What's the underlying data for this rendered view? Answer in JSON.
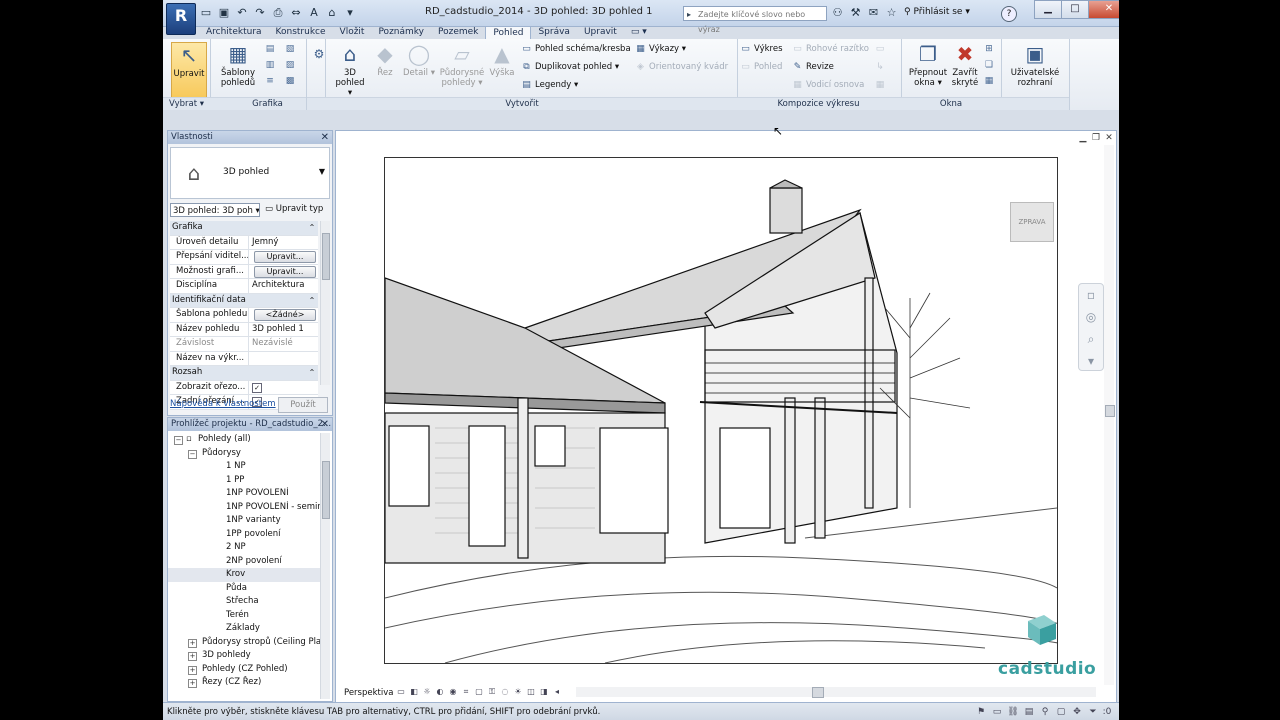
{
  "titlebar": {
    "app_menu": "R",
    "title": "RD_cadstudio_2014 - 3D pohled: 3D pohled 1",
    "search_placeholder": "Zadejte klíčové slovo nebo výraz",
    "signin": "Přihlásit se",
    "help": "?"
  },
  "tabs": [
    "Architektura",
    "Konstrukce",
    "Vložit",
    "Poznámky",
    "Pozemek",
    "Pohled",
    "Správa",
    "Upravit"
  ],
  "ribbon": {
    "select": {
      "upravit": "Upravit",
      "label": "Vybrat"
    },
    "grafika": {
      "sablony": [
        "Šablony",
        "pohledů"
      ],
      "label": "Grafika"
    },
    "vytvorit": {
      "pohled3d": [
        "3D",
        "pohled"
      ],
      "rez": "Řez",
      "detail": "Detail",
      "pudorysne": [
        "Půdorysné",
        "pohledy"
      ],
      "vyska": "Výška",
      "schema": "Pohled schéma/kresba",
      "duplikovat": "Duplikovat pohled",
      "legendy": "Legendy",
      "vykazy": "Výkazy",
      "orientovany": "Orientovaný kvádr",
      "label": "Vytvořit"
    },
    "kompozice": {
      "vykres": "Výkres",
      "pohled": "Pohled",
      "rohove": "Rohové razítko",
      "revize": "Revize",
      "vodici": "Vodicí osnova",
      "label": "Kompozice výkresu"
    },
    "okna": {
      "prepnout": [
        "Přepnout",
        "okna"
      ],
      "zavrit": [
        "Zavřít",
        "skryté"
      ],
      "uzivatelske": [
        "Uživatelské",
        "rozhraní"
      ],
      "label": "Okna"
    }
  },
  "properties": {
    "title": "Vlastnosti",
    "type_name": "3D pohled",
    "type_selector": "3D pohled: 3D poh",
    "edit_type": "Upravit typ",
    "rows": [
      {
        "group": "Grafika"
      },
      {
        "k": "Úroveň detailu",
        "v": "Jemný"
      },
      {
        "k": "Přepsání viditel...",
        "btn": "Upravit..."
      },
      {
        "k": "Možnosti grafi...",
        "btn": "Upravit..."
      },
      {
        "k": "Disciplína",
        "v": "Architektura"
      },
      {
        "group": "Identifikační data"
      },
      {
        "k": "Šablona pohledu",
        "btn": "<Žádné>"
      },
      {
        "k": "Název pohledu",
        "v": "3D pohled 1"
      },
      {
        "k": "Závislost",
        "v": "Nezávislé",
        "dim": true
      },
      {
        "k": "Název na výkr...",
        "v": ""
      },
      {
        "group": "Rozsah"
      },
      {
        "k": "Zobrazit ořezo...",
        "check": "✓"
      },
      {
        "k": "Zadní ořezání ...",
        "check": "✓"
      }
    ],
    "help_link": "Nápověda k vlastnostem",
    "apply": "Použít"
  },
  "browser": {
    "title": "Prohlížeč projektu - RD_cadstudio_2...",
    "items": [
      {
        "label": "Pohledy (all)",
        "level": 0,
        "pm": "−"
      },
      {
        "label": "Půdorysy",
        "level": 1,
        "pm": "−"
      },
      {
        "label": "1 NP",
        "level": 2
      },
      {
        "label": "1 PP",
        "level": 2
      },
      {
        "label": "1NP POVOLENÍ",
        "level": 2
      },
      {
        "label": "1NP POVOLENÍ - seminá",
        "level": 2
      },
      {
        "label": "1NP varianty",
        "level": 2
      },
      {
        "label": "1PP povolení",
        "level": 2
      },
      {
        "label": "2 NP",
        "level": 2
      },
      {
        "label": "2NP povolení",
        "level": 2
      },
      {
        "label": "Krov",
        "level": 2,
        "selected": true
      },
      {
        "label": "Půda",
        "level": 2
      },
      {
        "label": "Střecha",
        "level": 2
      },
      {
        "label": "Terén",
        "level": 2
      },
      {
        "label": "Základy",
        "level": 2
      },
      {
        "label": "Půdorysy stropů (Ceiling Plan",
        "level": 1,
        "pm": "+"
      },
      {
        "label": "3D pohledy",
        "level": 1,
        "pm": "+"
      },
      {
        "label": "Pohledy (CZ Pohled)",
        "level": 1,
        "pm": "+"
      },
      {
        "label": "Řezy (CZ Řez)",
        "level": 1,
        "pm": "+"
      }
    ]
  },
  "canvas": {
    "viewcube": "ZPRAVA",
    "viewbar_label": "Perspektiva",
    "brand": "cadstudio"
  },
  "status": {
    "text": "Klikněte pro výběr, stiskněte klávesu TAB pro alternativy, CTRL pro přidání, SHIFT pro odebrání prvků.",
    "filter_count": ":0"
  },
  "colors": {
    "accent": "#3a9fa0",
    "ribbon_sel": "#f7c95b"
  }
}
